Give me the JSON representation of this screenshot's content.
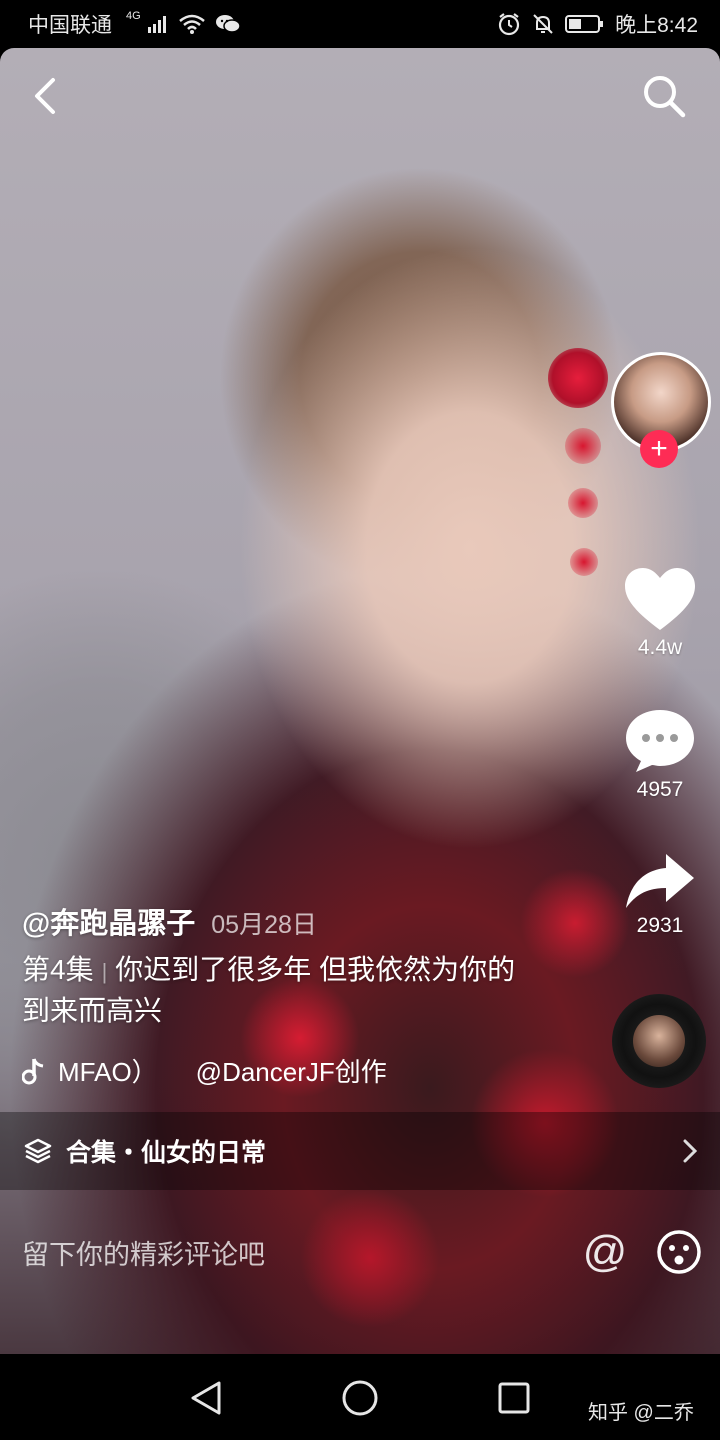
{
  "status_bar": {
    "carrier": "中国联通",
    "network": "4G",
    "time": "晚上8:42",
    "icons": [
      "signal-icon",
      "wifi-icon",
      "wechat-icon",
      "alarm-icon",
      "mute-icon",
      "battery-icon"
    ]
  },
  "top_bar": {
    "back_icon": "chevron-left-icon",
    "search_icon": "search-icon"
  },
  "side_rail": {
    "likes": "4.4w",
    "comments": "4957",
    "shares": "2931",
    "follow_symbol": "+"
  },
  "post": {
    "author": "@奔跑晶骡子",
    "date": "05月28日",
    "episode": "第4集",
    "episode_separator": "|",
    "caption": "你迟到了很多年 但我依然为你的到来而高兴",
    "music": "MFAO）",
    "music_credit": "@DancerJF创作"
  },
  "collection": {
    "label": "合集・仙女的日常"
  },
  "comment_bar": {
    "placeholder": "留下你的精彩评论吧",
    "at_symbol": "@"
  },
  "footer": {
    "watermark": "知乎 @二乔"
  },
  "colors": {
    "accent": "#fe2c55",
    "like": "#ffffff"
  }
}
